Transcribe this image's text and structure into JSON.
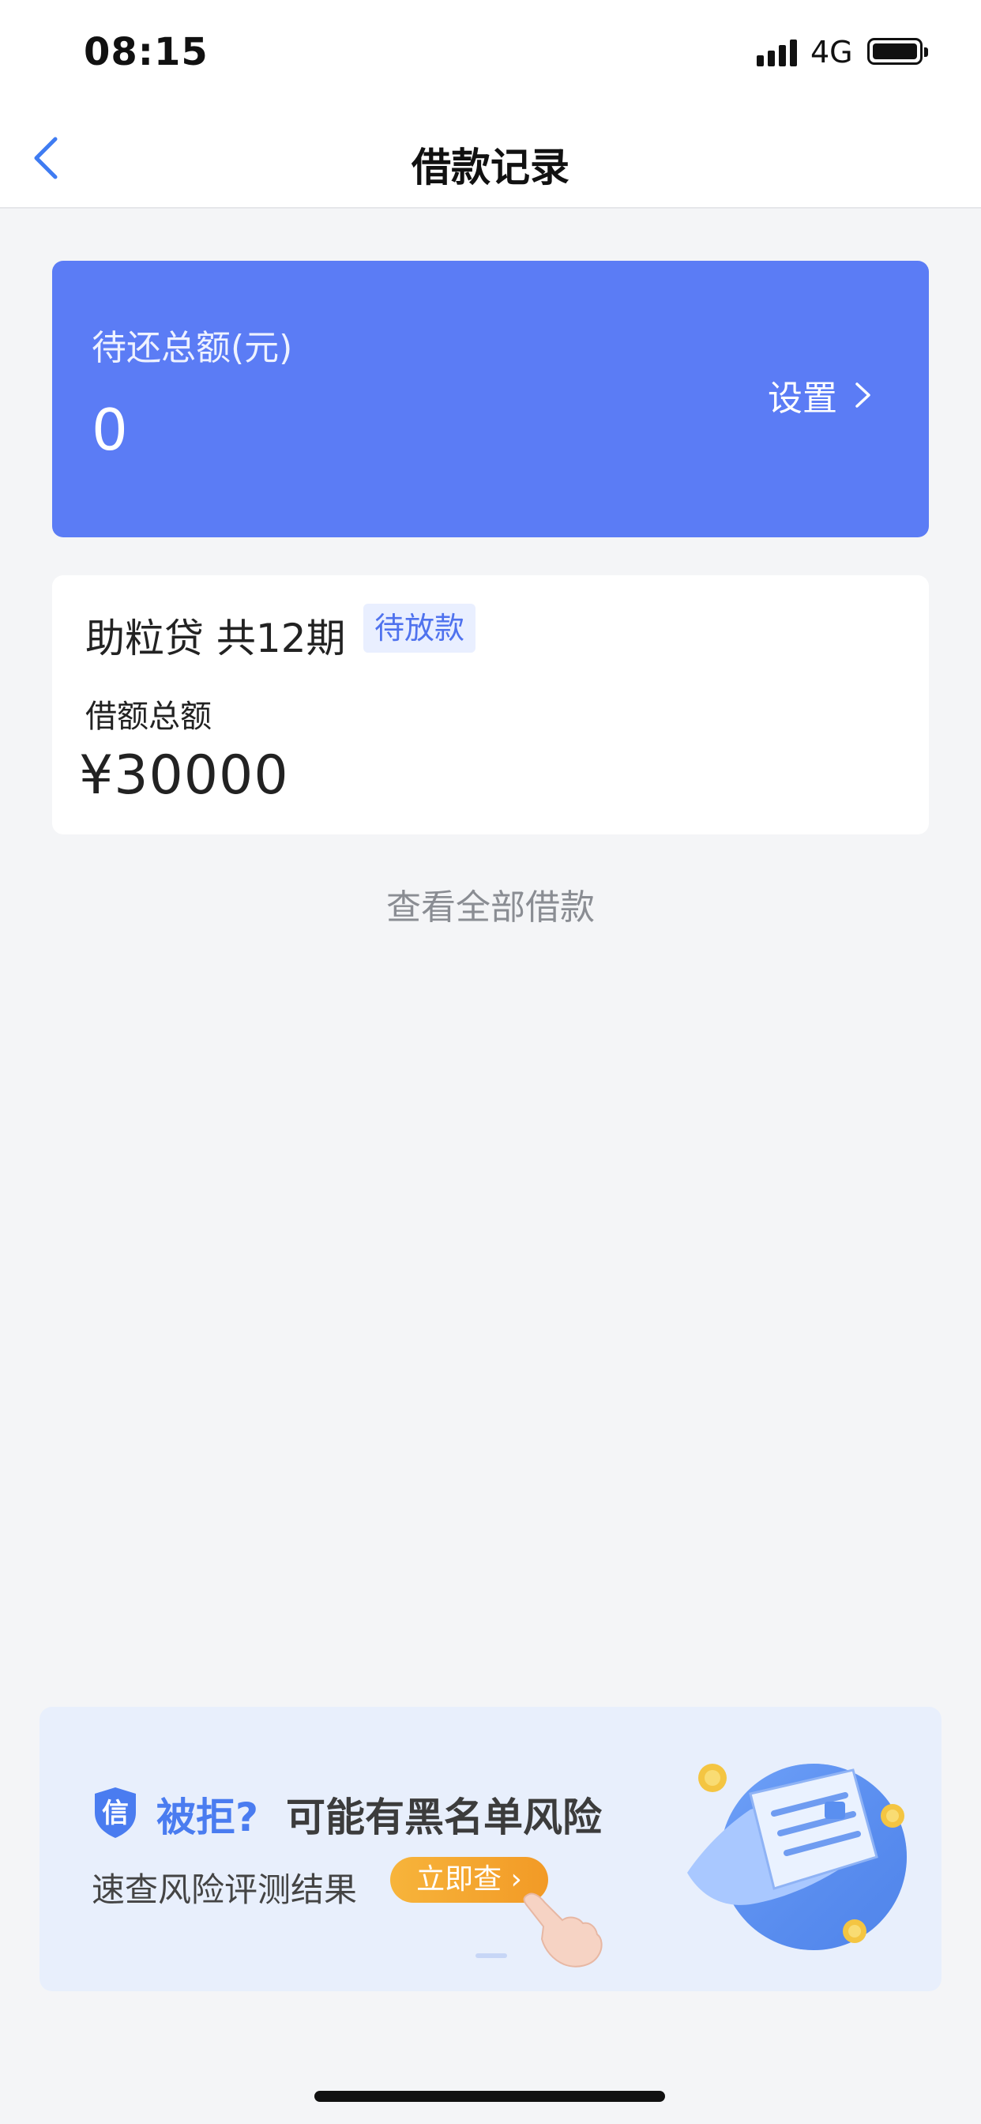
{
  "status_bar": {
    "time": "08:15",
    "network": "4G"
  },
  "nav": {
    "title": "借款记录"
  },
  "summary": {
    "label": "待还总额(元)",
    "amount": "0",
    "settings_label": "设置"
  },
  "loan": {
    "name": "助粒贷 共12期",
    "status": "待放款",
    "amount_label": "借额总额",
    "amount": "¥30000"
  },
  "view_all": "查看全部借款",
  "banner": {
    "title_highlight": "被拒?",
    "title_rest": "可能有黑名单风险",
    "subtitle": "速查风险评测结果",
    "button_label": "立即查",
    "shield_char": "信"
  },
  "colors": {
    "accent": "#5b7cf5",
    "badge_text": "#4f72ee",
    "banner_bg": "#e8effc",
    "button": "#f29a26"
  }
}
